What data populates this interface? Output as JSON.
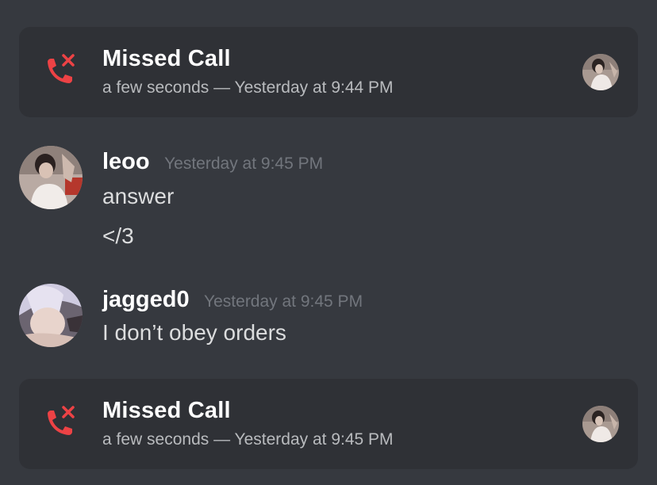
{
  "colors": {
    "background": "#36393f",
    "card": "#2f3136",
    "missed_call_red": "#ed4245",
    "username": "#ffffff",
    "timestamp": "#72767d",
    "message_text": "#dcddde"
  },
  "calls": [
    {
      "icon": "missed-call-icon",
      "title": "Missed Call",
      "subtitle": "a few seconds — Yesterday at 9:44 PM"
    },
    {
      "icon": "missed-call-icon",
      "title": "Missed Call",
      "subtitle": "a few seconds — Yesterday at 9:45 PM"
    }
  ],
  "messages": [
    {
      "username": "leoo",
      "timestamp": "Yesterday at 9:45 PM",
      "lines": [
        "answer",
        "</3"
      ]
    },
    {
      "username": "jagged0",
      "timestamp": "Yesterday at 9:45 PM",
      "lines": [
        "I don’t obey orders"
      ]
    }
  ]
}
